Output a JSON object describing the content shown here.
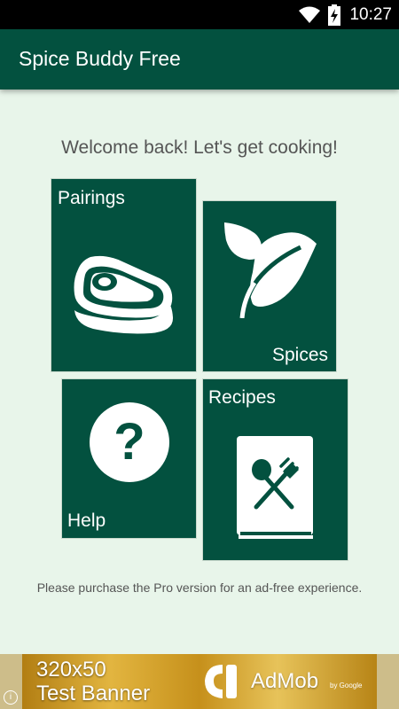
{
  "status_bar": {
    "time": "10:27",
    "icons": [
      "wifi-icon",
      "battery-charging-icon"
    ]
  },
  "app_bar": {
    "title": "Spice Buddy Free",
    "color": "#03513f"
  },
  "main": {
    "welcome": "Welcome back! Let's get cooking!",
    "tiles": [
      {
        "label": "Pairings",
        "icon": "steak-icon"
      },
      {
        "label": "Spices",
        "icon": "leaf-icon"
      },
      {
        "label": "Help",
        "icon": "question-icon"
      },
      {
        "label": "Recipes",
        "icon": "recipe-book-icon"
      }
    ],
    "footnote": "Please purchase the Pro version for an ad-free experience."
  },
  "ad": {
    "line1": "320x50",
    "line2": "Test Banner",
    "brand": "AdMob",
    "brand_sub": "by Google",
    "info": "i"
  }
}
